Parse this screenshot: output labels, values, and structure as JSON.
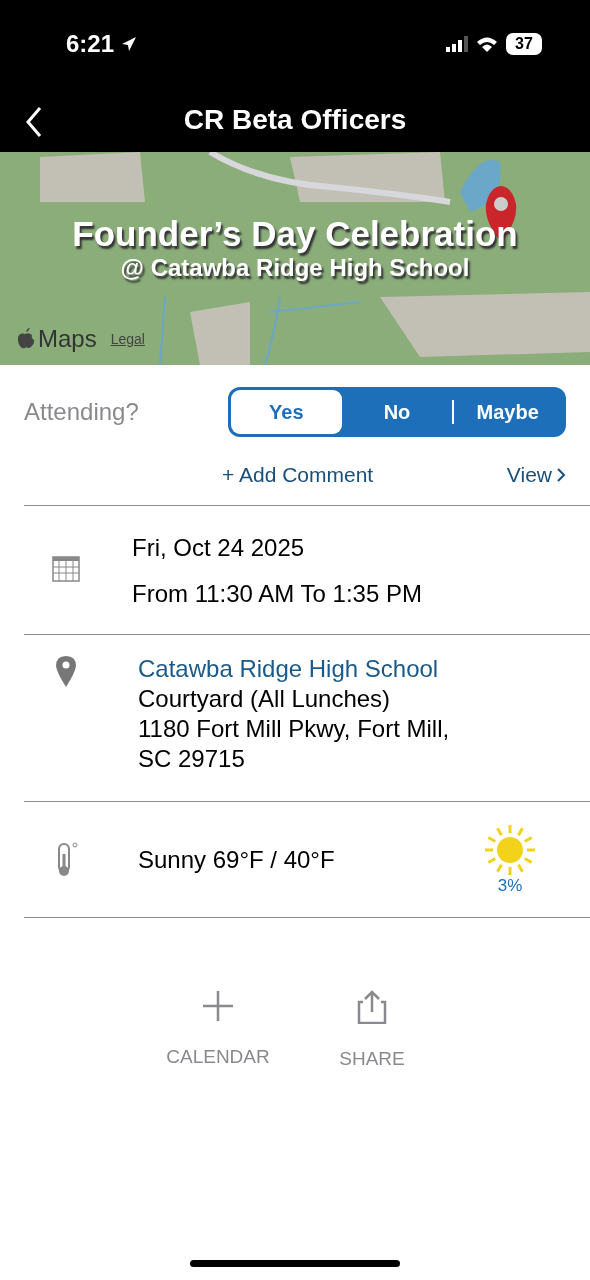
{
  "status_bar": {
    "time": "6:21",
    "battery": "37"
  },
  "nav": {
    "title": "CR Beta Officers"
  },
  "header": {
    "title": "Founder’s Day Celebration",
    "subtitle": "@ Catawba Ridge High School",
    "map_logo": "Maps",
    "legal": "Legal"
  },
  "attending": {
    "label": "Attending?",
    "options": [
      {
        "label": "Yes",
        "selected": true
      },
      {
        "label": "No",
        "selected": false
      },
      {
        "label": "Maybe",
        "selected": false
      }
    ],
    "add_comment": "+ Add Comment",
    "view": "View"
  },
  "date": {
    "day": "Fri, Oct 24 2025",
    "time": "From 11:30 AM To 1:35 PM"
  },
  "location": {
    "name": "Catawba Ridge High School",
    "lines": [
      "Courtyard (All Lunches)",
      "1180 Fort Mill Pkwy, Fort Mill,",
      "SC 29715"
    ]
  },
  "weather": {
    "summary": "Sunny 69°F / 40°F",
    "precip": "3%"
  },
  "actions": [
    {
      "label": "CALENDAR",
      "kind": "add"
    },
    {
      "label": "SHARE",
      "kind": "share"
    }
  ]
}
